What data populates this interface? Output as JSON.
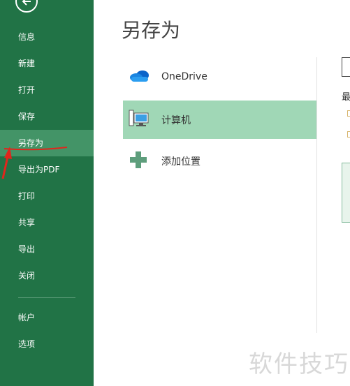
{
  "sidebar": {
    "items": [
      {
        "label": "信息"
      },
      {
        "label": "新建"
      },
      {
        "label": "打开"
      },
      {
        "label": "保存"
      },
      {
        "label": "另存为"
      },
      {
        "label": "导出为PDF"
      },
      {
        "label": "打印"
      },
      {
        "label": "共享"
      },
      {
        "label": "导出"
      },
      {
        "label": "关闭"
      },
      {
        "label": "帐户"
      },
      {
        "label": "选项"
      }
    ],
    "active_index": 4
  },
  "main": {
    "title": "另存为",
    "locations": [
      {
        "label": "OneDrive",
        "icon": "onedrive-cloud-icon"
      },
      {
        "label": "计算机",
        "icon": "computer-icon"
      },
      {
        "label": "添加位置",
        "icon": "plus-icon"
      }
    ]
  },
  "right_panel": {
    "partial_text": "最"
  },
  "watermark": "软件技巧",
  "colors": {
    "sidebar_bg": "#217346",
    "sidebar_active": "#439467",
    "selected_location": "#a0d7b6",
    "annotation_red": "#e0261c"
  }
}
